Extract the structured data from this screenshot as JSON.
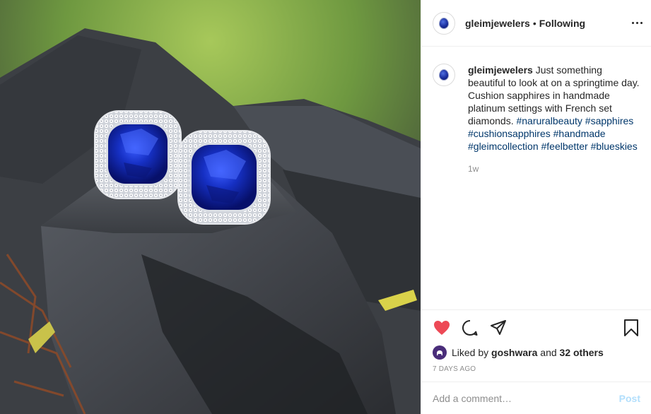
{
  "post": {
    "username": "gleimjewelers",
    "separator": "•",
    "follow_status": "Following",
    "more_icon": "more-horizontal-icon"
  },
  "caption": {
    "username": "gleimjewelers",
    "text": "Just something beautiful to look at on a springtime day. Cushion sapphires in handmade platinum settings with French set diamonds.",
    "hashtags": [
      "#naruralbeauty",
      "#sapphires",
      "#cushionsapphires",
      "#handmade",
      "#gleimcollection",
      "#feelbetter",
      "#blueskies"
    ],
    "age": "1w"
  },
  "actions": {
    "like_icon": "heart-filled-icon",
    "comment_icon": "comment-icon",
    "share_icon": "share-icon",
    "save_icon": "bookmark-icon",
    "like_color": "#ed4956"
  },
  "likes": {
    "prefix": "Liked by",
    "user": "goshwara",
    "and": "and",
    "others": "32 others"
  },
  "timestamp": "7 DAYS AGO",
  "comment": {
    "placeholder": "Add a comment…",
    "post_label": "Post"
  },
  "colors": {
    "link": "#00376b",
    "muted": "#8e8e8e",
    "post_disabled": "#b2dffc"
  }
}
